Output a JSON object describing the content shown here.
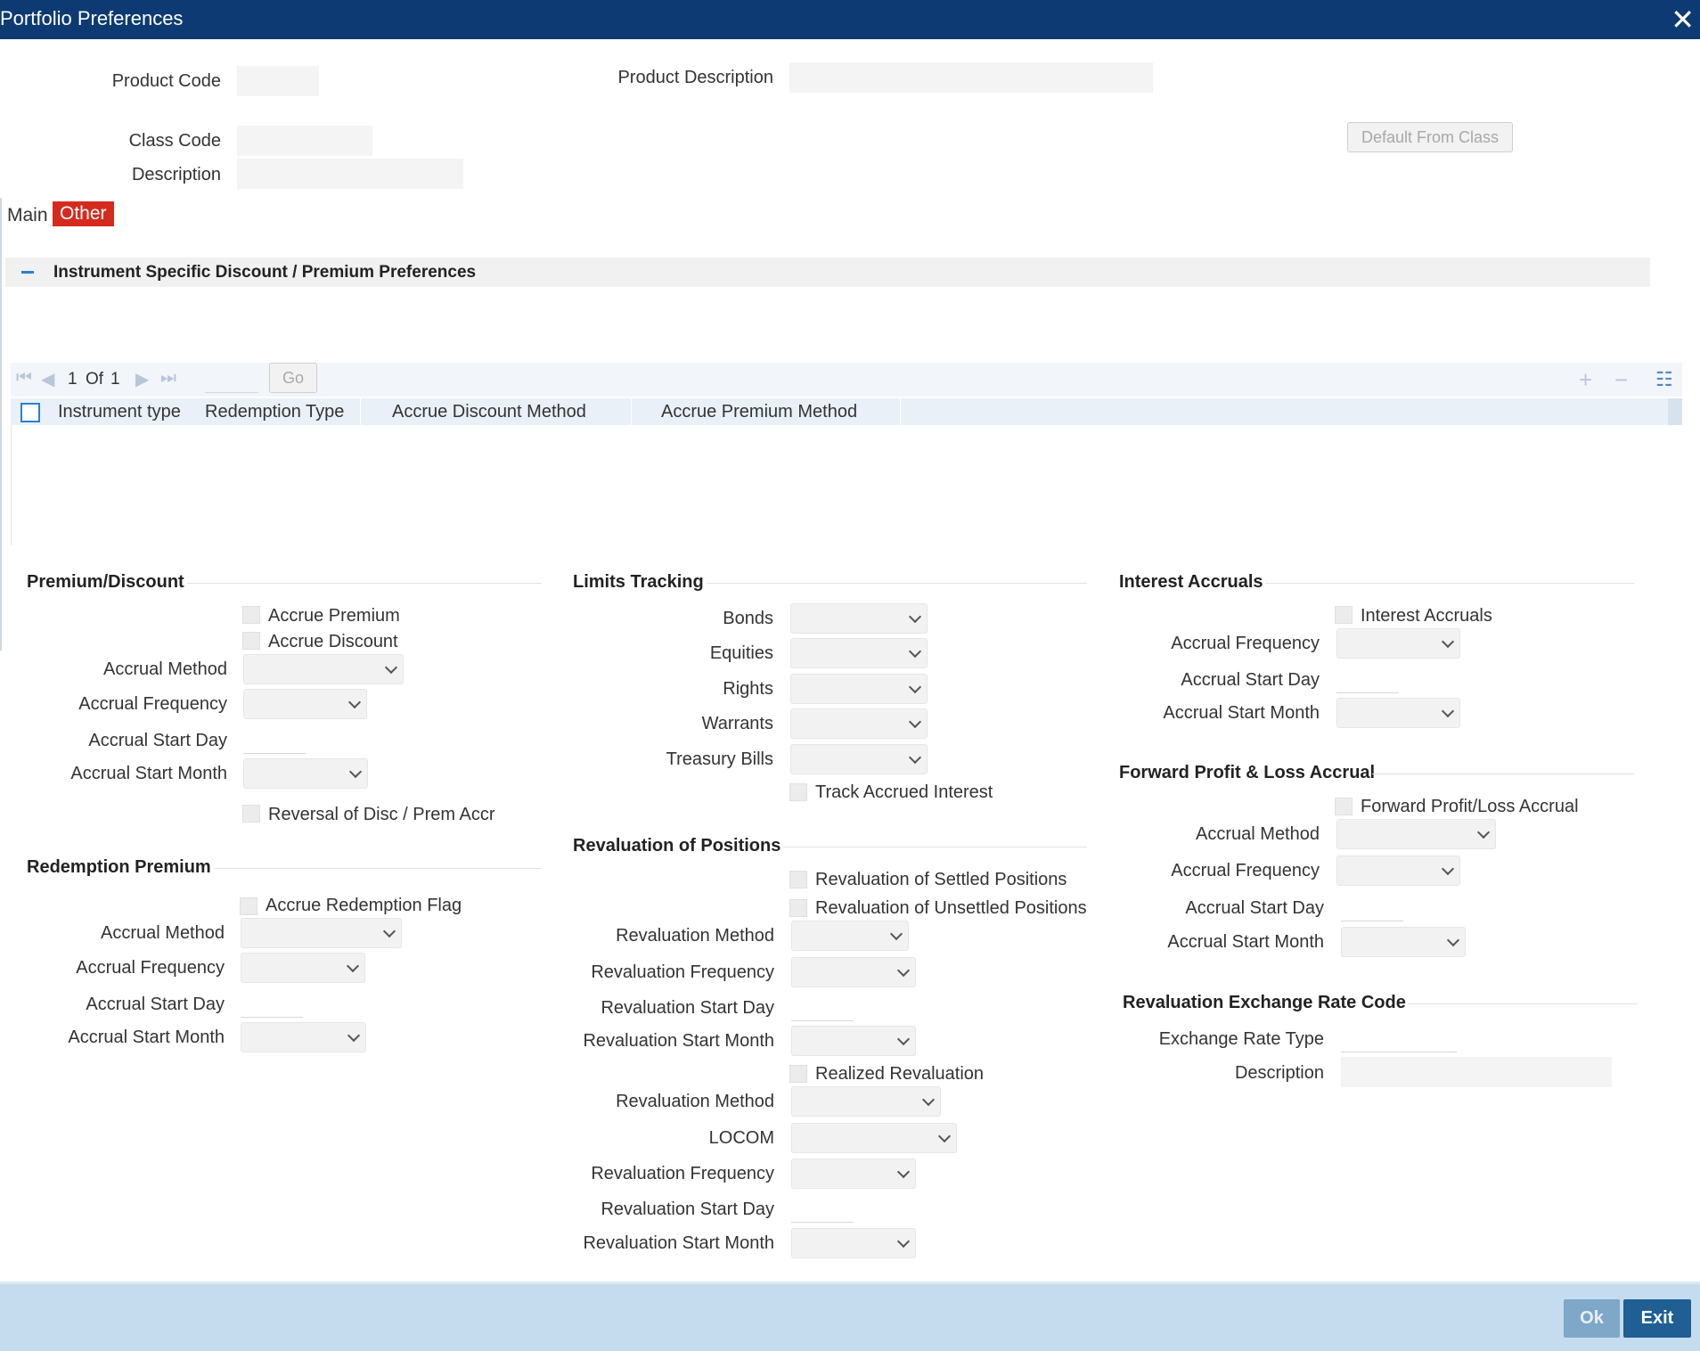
{
  "window": {
    "title": "Portfolio Preferences"
  },
  "header": {
    "product_code_label": "Product Code",
    "product_description_label": "Product Description",
    "class_code_label": "Class Code",
    "description_label": "Description",
    "default_from_class_label": "Default From Class"
  },
  "tabs": {
    "main": "Main",
    "other": "Other"
  },
  "instrument_section": {
    "title": "Instrument Specific Discount / Premium Preferences",
    "pager": {
      "current": "1",
      "of": "Of",
      "total": "1",
      "go": "Go"
    },
    "columns": [
      "Instrument type",
      "Redemption Type",
      "Accrue Discount Method",
      "Accrue Premium Method"
    ]
  },
  "premium_discount": {
    "title": "Premium/Discount",
    "accrue_premium": "Accrue Premium",
    "accrue_discount": "Accrue Discount",
    "accrual_method": "Accrual Method",
    "accrual_frequency": "Accrual Frequency",
    "accrual_start_day": "Accrual Start Day",
    "accrual_start_month": "Accrual Start Month",
    "reversal": "Reversal of Disc / Prem Accr"
  },
  "redemption_premium": {
    "title": "Redemption Premium",
    "accrue_flag": "Accrue Redemption Flag",
    "accrual_method": "Accrual Method",
    "accrual_frequency": "Accrual Frequency",
    "accrual_start_day": "Accrual Start Day",
    "accrual_start_month": "Accrual Start Month"
  },
  "limits_tracking": {
    "title": "Limits Tracking",
    "bonds": "Bonds",
    "equities": "Equities",
    "rights": "Rights",
    "warrants": "Warrants",
    "treasury_bills": "Treasury Bills",
    "track_accrued_interest": "Track Accrued Interest"
  },
  "revaluation_positions": {
    "title": "Revaluation of Positions",
    "settled": "Revaluation of Settled Positions",
    "unsettled": "Revaluation of Unsettled Positions",
    "method": "Revaluation Method",
    "frequency": "Revaluation Frequency",
    "start_day": "Revaluation Start Day",
    "start_month": "Revaluation Start Month",
    "realized": "Realized Revaluation",
    "realized_method": "Revaluation Method",
    "locom": "LOCOM",
    "realized_frequency": "Revaluation Frequency",
    "realized_start_day": "Revaluation Start Day",
    "realized_start_month": "Revaluation Start Month"
  },
  "interest_accruals": {
    "title": "Interest Accruals",
    "flag": "Interest Accruals",
    "accrual_frequency": "Accrual Frequency",
    "accrual_start_day": "Accrual Start Day",
    "accrual_start_month": "Accrual Start Month"
  },
  "forward_pl": {
    "title": "Forward Profit & Loss Accrual",
    "flag": "Forward Profit/Loss Accrual",
    "accrual_method": "Accrual Method",
    "accrual_frequency": "Accrual Frequency",
    "accrual_start_day": "Accrual Start Day",
    "accrual_start_month": "Accrual Start Month"
  },
  "reval_exchange": {
    "title": "Revaluation Exchange Rate Code",
    "exchange_rate_type": "Exchange Rate Type",
    "description": "Description"
  },
  "footer": {
    "ok": "Ok",
    "exit": "Exit"
  }
}
